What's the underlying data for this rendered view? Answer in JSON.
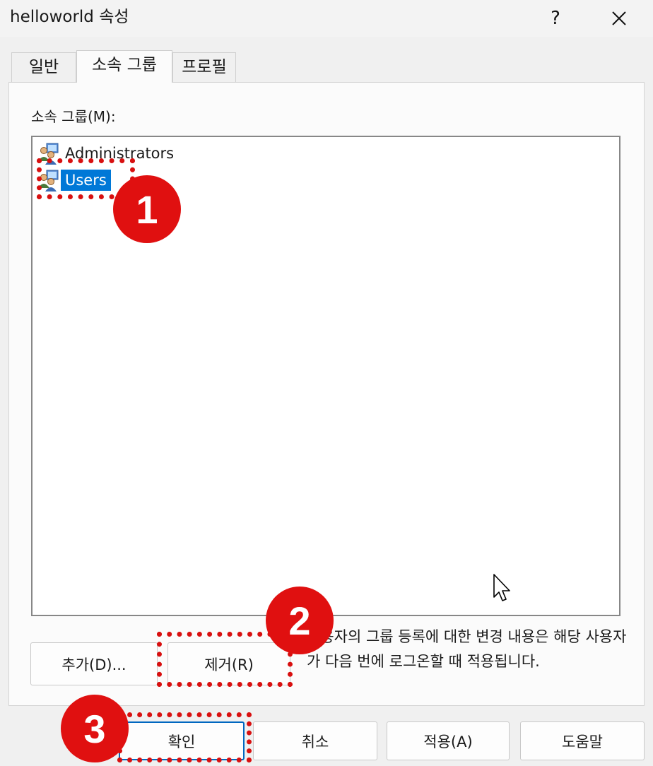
{
  "window": {
    "title": "helloworld 속성",
    "help_label": "?",
    "close_label": "✕"
  },
  "tabs": [
    {
      "label": "일반",
      "active": false
    },
    {
      "label": "소속 그룹",
      "active": true
    },
    {
      "label": "프로필",
      "active": false
    }
  ],
  "member_of": {
    "label": "소속 그룹(M):",
    "items": [
      {
        "name": "Administrators",
        "icon": "group-icon",
        "selected": false
      },
      {
        "name": "Users",
        "icon": "group-icon",
        "selected": true
      }
    ]
  },
  "actions": {
    "add_label": "추가(D)...",
    "remove_label": "제거(R)"
  },
  "info_text": "사용자의 그룹 등록에 대한 변경 내용은 해당 사용자가 다음 번에 로그온할 때 적용됩니다.",
  "footer": {
    "ok_label": "확인",
    "cancel_label": "취소",
    "apply_label": "적용(A)",
    "help_label": "도움말"
  },
  "annotations": {
    "badge_1": "1",
    "badge_2": "2",
    "badge_3": "3",
    "color": "#e01010"
  }
}
